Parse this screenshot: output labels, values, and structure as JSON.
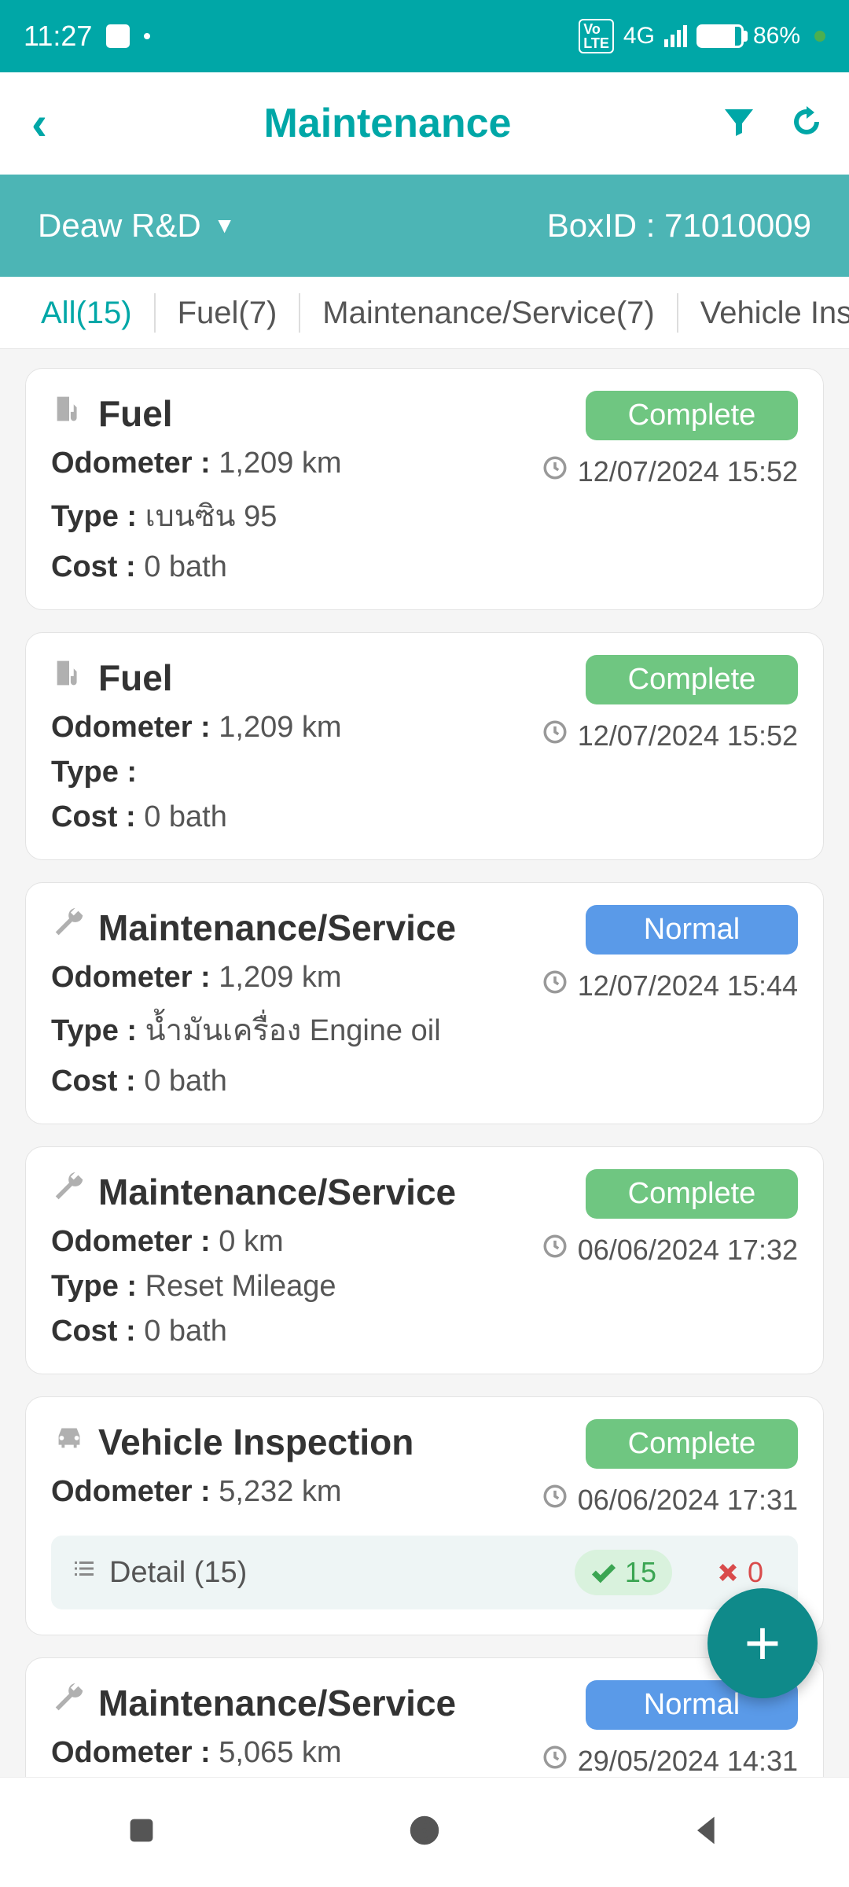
{
  "status": {
    "time": "11:27",
    "network": "4G",
    "battery": "86%"
  },
  "header": {
    "title": "Maintenance"
  },
  "org": {
    "name": "Deaw R&D",
    "boxid_label": "BoxID :",
    "boxid": "71010009"
  },
  "tabs": [
    {
      "label": "All(15)",
      "active": true
    },
    {
      "label": "Fuel(7)",
      "active": false
    },
    {
      "label": "Maintenance/Service(7)",
      "active": false
    },
    {
      "label": "Vehicle Inspection(",
      "active": false
    }
  ],
  "labels": {
    "odometer": "Odometer :",
    "type": "Type :",
    "cost": "Cost :",
    "detail": "Detail"
  },
  "cards": [
    {
      "icon": "fuel",
      "title": "Fuel",
      "status": "Complete",
      "status_kind": "complete",
      "odometer": "1,209 km",
      "type": "เบนซิน 95",
      "cost": "0 bath",
      "time": "12/07/2024 15:52"
    },
    {
      "icon": "fuel",
      "title": "Fuel",
      "status": "Complete",
      "status_kind": "complete",
      "odometer": "1,209 km",
      "type": "",
      "cost": "0 bath",
      "time": "12/07/2024 15:52"
    },
    {
      "icon": "wrench",
      "title": "Maintenance/Service",
      "status": "Normal",
      "status_kind": "normal",
      "odometer": "1,209 km",
      "type": "น้ำมันเครื่อง Engine oil",
      "cost": "0 bath",
      "time": "12/07/2024 15:44"
    },
    {
      "icon": "wrench",
      "title": "Maintenance/Service",
      "status": "Complete",
      "status_kind": "complete",
      "odometer": "0 km",
      "type": "Reset Mileage",
      "cost": "0 bath",
      "time": "06/06/2024 17:32"
    },
    {
      "icon": "car",
      "title": "Vehicle Inspection",
      "status": "Complete",
      "status_kind": "complete",
      "odometer": "5,232 km",
      "time": "06/06/2024 17:31",
      "detail": {
        "count": "(15)",
        "pass": "15",
        "fail": "0"
      }
    },
    {
      "icon": "wrench",
      "title": "Maintenance/Service",
      "status": "Normal",
      "status_kind": "normal",
      "odometer": "5,065 km",
      "time": "29/05/2024 14:31"
    }
  ]
}
